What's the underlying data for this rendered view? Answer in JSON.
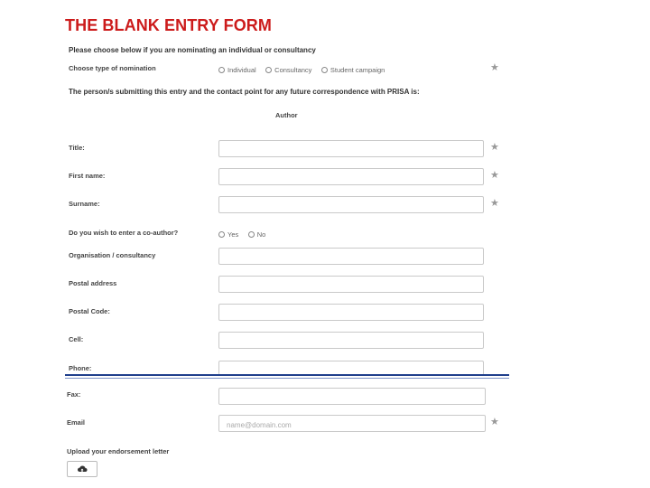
{
  "slide": {
    "title": "THE BLANK ENTRY FORM"
  },
  "form": {
    "intro": "Please choose below if you are nominating an individual or consultancy",
    "nomination": {
      "label": "Choose type of nomination",
      "options": [
        "Individual",
        "Consultancy",
        "Student campaign"
      ]
    },
    "contact_heading_pre": "The person/s submitting this entry and the contact point for any future correspondence with ",
    "contact_heading_brand": "PRISA",
    "contact_heading_post": " is:",
    "section_label": "Author",
    "fields": {
      "title": {
        "label": "Title:"
      },
      "first_name": {
        "label": "First name:"
      },
      "surname": {
        "label": "Surname:"
      },
      "coauthor": {
        "label": "Do you wish to enter a co-author?",
        "options": [
          "Yes",
          "No"
        ]
      },
      "organisation": {
        "label": "Organisation / consultancy"
      },
      "postal_address": {
        "label": "Postal address"
      },
      "postal_code": {
        "label": "Postal Code:"
      },
      "cell": {
        "label": "Cell:"
      },
      "phone": {
        "label": "Phone:"
      },
      "fax": {
        "label": "Fax:"
      },
      "email": {
        "label": "Email",
        "placeholder": "name@domain.com"
      }
    },
    "upload": {
      "label": "Upload your endorsement letter",
      "icon": "cloud-upload-icon"
    }
  },
  "colors": {
    "title": "#cc1b1b",
    "divider": "#1f3f8c"
  },
  "icons": {
    "required": "star-icon"
  }
}
